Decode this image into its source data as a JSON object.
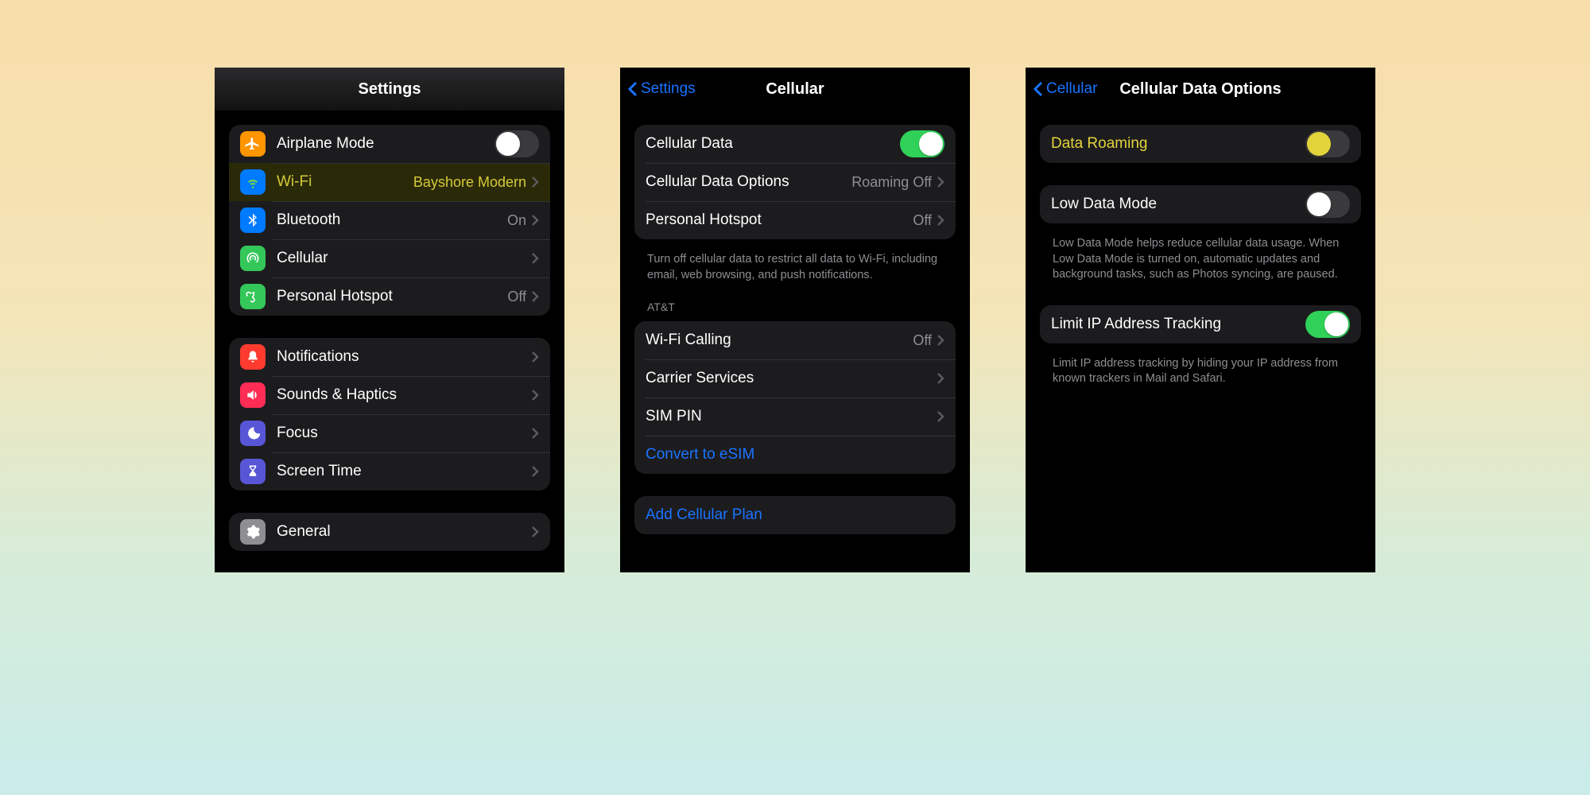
{
  "screen1": {
    "title": "Settings",
    "group1": {
      "airplane": "Airplane Mode",
      "wifi": "Wi-Fi",
      "wifi_value": "Bayshore Modern",
      "bluetooth": "Bluetooth",
      "bluetooth_value": "On",
      "cellular": "Cellular",
      "hotspot": "Personal Hotspot",
      "hotspot_value": "Off"
    },
    "group2": {
      "notifications": "Notifications",
      "sounds": "Sounds & Haptics",
      "focus": "Focus",
      "screentime": "Screen Time"
    },
    "group3": {
      "general": "General"
    }
  },
  "screen2": {
    "back": "Settings",
    "title": "Cellular",
    "group1": {
      "cell_data": "Cellular Data",
      "options": "Cellular Data Options",
      "options_value": "Roaming Off",
      "hotspot": "Personal Hotspot",
      "hotspot_value": "Off"
    },
    "footer1": "Turn off cellular data to restrict all data to Wi-Fi, including email, web browsing, and push notifications.",
    "header2": "AT&T",
    "group2": {
      "wifi_calling": "Wi-Fi Calling",
      "wifi_calling_value": "Off",
      "carrier": "Carrier Services",
      "sim_pin": "SIM PIN",
      "convert": "Convert to eSIM"
    },
    "group3": {
      "add_plan": "Add Cellular Plan"
    }
  },
  "screen3": {
    "back": "Cellular",
    "title": "Cellular Data Options",
    "group1": {
      "roaming": "Data Roaming"
    },
    "group2": {
      "low_data": "Low Data Mode"
    },
    "footer2": "Low Data Mode helps reduce cellular data usage. When Low Data Mode is turned on, automatic updates and background tasks, such as Photos syncing, are paused.",
    "group3": {
      "limit_ip": "Limit IP Address Tracking"
    },
    "footer3": "Limit IP address tracking by hiding your IP address from known trackers in Mail and Safari."
  }
}
